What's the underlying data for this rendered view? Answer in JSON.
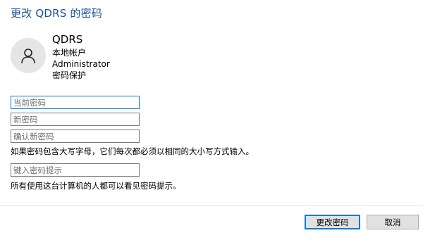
{
  "dialog": {
    "title": "更改 QDRS 的密码"
  },
  "user": {
    "name": "QDRS",
    "account_type": "本地帐户",
    "group": "Administrator",
    "protection": "密码保护"
  },
  "fields": {
    "current_password": {
      "placeholder": "当前密码",
      "value": ""
    },
    "new_password": {
      "placeholder": "新密码",
      "value": ""
    },
    "confirm_password": {
      "placeholder": "确认新密码",
      "value": ""
    },
    "password_hint": {
      "placeholder": "键入密码提示",
      "value": ""
    }
  },
  "notes": {
    "case_sensitive": "如果密码包含大写字母，它们每次都必须以相同的大小写方式输入。",
    "hint_visibility": "所有使用这台计算机的人都可以看见密码提示。"
  },
  "buttons": {
    "change_password": "更改密码",
    "cancel": "取消"
  },
  "icons": {
    "avatar": "user-silhouette-icon"
  },
  "colors": {
    "title": "#1a4f9c",
    "focus_border": "#0078d7",
    "button_bg": "#e1e1e1"
  }
}
